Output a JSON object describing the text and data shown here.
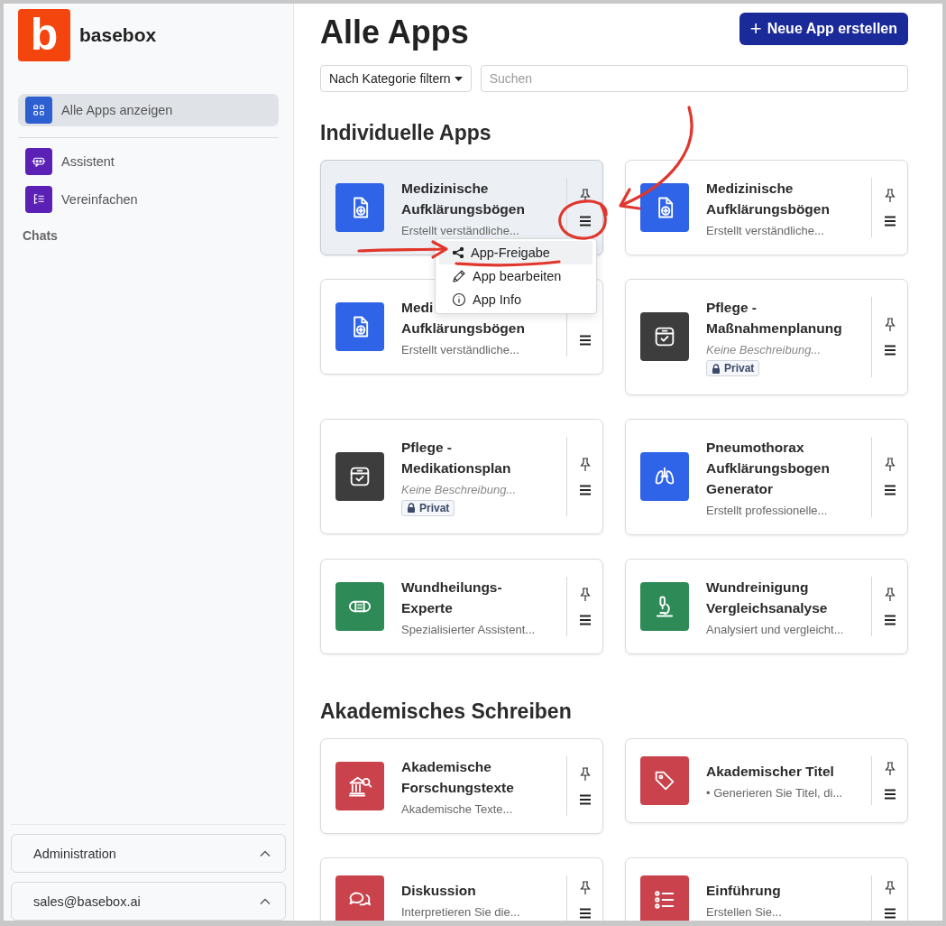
{
  "sidebar": {
    "logo": {
      "letter": "b",
      "name": "basebox"
    },
    "nav": [
      {
        "label": "Alle Apps anzeigen",
        "kind": "grid",
        "selected": true
      }
    ],
    "tools": [
      {
        "label": "Assistent",
        "kind": "robot",
        "selected": false
      },
      {
        "label": "Vereinfachen",
        "kind": "tree",
        "selected": false
      }
    ],
    "chats_heading": "Chats",
    "footer": [
      {
        "label": "Administration",
        "expanded": true
      },
      {
        "label": "sales@basebox.ai",
        "expanded": true
      }
    ]
  },
  "header": {
    "title": "Alle Apps",
    "create_button": {
      "icon": "+",
      "label": "Neue App erstellen"
    },
    "filter": {
      "label": "Nach Kategorie filtern"
    },
    "search": {
      "placeholder": "Suchen"
    }
  },
  "sections": [
    {
      "title": "Individuelle Apps",
      "cards": [
        {
          "title_lines": [
            "Medizinische",
            "Aufklärungsbögen"
          ],
          "description": "Erstellt verständliche...",
          "kind": "document",
          "color": "#2f63e8",
          "selected": true,
          "description_empty": false,
          "private": false
        },
        {
          "title_lines": [
            "Medizinische",
            "Aufklärungsbögen"
          ],
          "description": "Erstellt verständliche...",
          "kind": "document",
          "color": "#2f63e8",
          "selected": false,
          "description_empty": false,
          "private": false
        },
        {
          "title_lines": [
            "Medi",
            "Aufklärungsbögen"
          ],
          "description": "Erstellt verständliche...",
          "kind": "document",
          "color": "#2f63e8",
          "selected": false,
          "description_empty": false,
          "private": false
        },
        {
          "title_lines": [
            "Pflege -",
            "Maßnahmenplanung"
          ],
          "description": "Keine Beschreibung...",
          "kind": "box",
          "color": "#3d3d3d",
          "selected": false,
          "description_empty": true,
          "private": true,
          "badge": "Privat"
        },
        {
          "title_lines": [
            "Pflege -",
            "Medikationsplan"
          ],
          "description": "Keine Beschreibung...",
          "kind": "box",
          "color": "#3d3d3d",
          "selected": false,
          "description_empty": true,
          "private": true,
          "badge": "Privat"
        },
        {
          "title_lines": [
            "Pneumothorax",
            "Aufklärungsbogen",
            "Generator"
          ],
          "description": "Erstellt professionelle...",
          "kind": "lungs",
          "color": "#2f63e8",
          "selected": false,
          "description_empty": false,
          "private": false
        },
        {
          "title_lines": [
            "Wundheilungs-",
            "Experte"
          ],
          "description": "Spezialisierter Assistent...",
          "kind": "bandage",
          "color": "#2e8a57",
          "selected": false,
          "description_empty": false,
          "private": false
        },
        {
          "title_lines": [
            "Wundreinigung",
            "Vergleichsanalyse"
          ],
          "description": "Analysiert und vergleicht...",
          "kind": "microscope",
          "color": "#2e8a57",
          "selected": false,
          "description_empty": false,
          "private": false
        }
      ]
    },
    {
      "title": "Akademisches Schreiben",
      "cards": [
        {
          "title_lines": [
            "Akademische",
            "Forschungstexte"
          ],
          "description": "Akademische Texte...",
          "kind": "bank",
          "color": "#c9424c",
          "selected": false,
          "description_empty": false,
          "private": false
        },
        {
          "title_lines": [
            "Akademischer Titel"
          ],
          "description": "•  Generieren Sie Titel, di...",
          "kind": "tag",
          "color": "#c9424c",
          "selected": false,
          "description_empty": false,
          "private": false
        },
        {
          "title_lines": [
            "Diskussion"
          ],
          "description": "Interpretieren Sie die...",
          "kind": "chat",
          "color": "#c9424c",
          "selected": false,
          "description_empty": false,
          "private": false
        },
        {
          "title_lines": [
            "Einführung"
          ],
          "description": "Erstellen Sie...",
          "kind": "list",
          "color": "#c9424c",
          "selected": false,
          "description_empty": false,
          "private": false
        }
      ]
    }
  ],
  "context_menu": {
    "items": [
      {
        "label": "App-Freigabe",
        "kind": "share",
        "selected": true
      },
      {
        "label": "App bearbeiten",
        "kind": "pencil",
        "selected": false
      },
      {
        "label": "App Info",
        "kind": "info",
        "selected": false
      }
    ]
  },
  "annotations": [
    {
      "kind": "curved-arrow"
    },
    {
      "kind": "circle"
    },
    {
      "kind": "arrow"
    },
    {
      "kind": "underline"
    }
  ]
}
